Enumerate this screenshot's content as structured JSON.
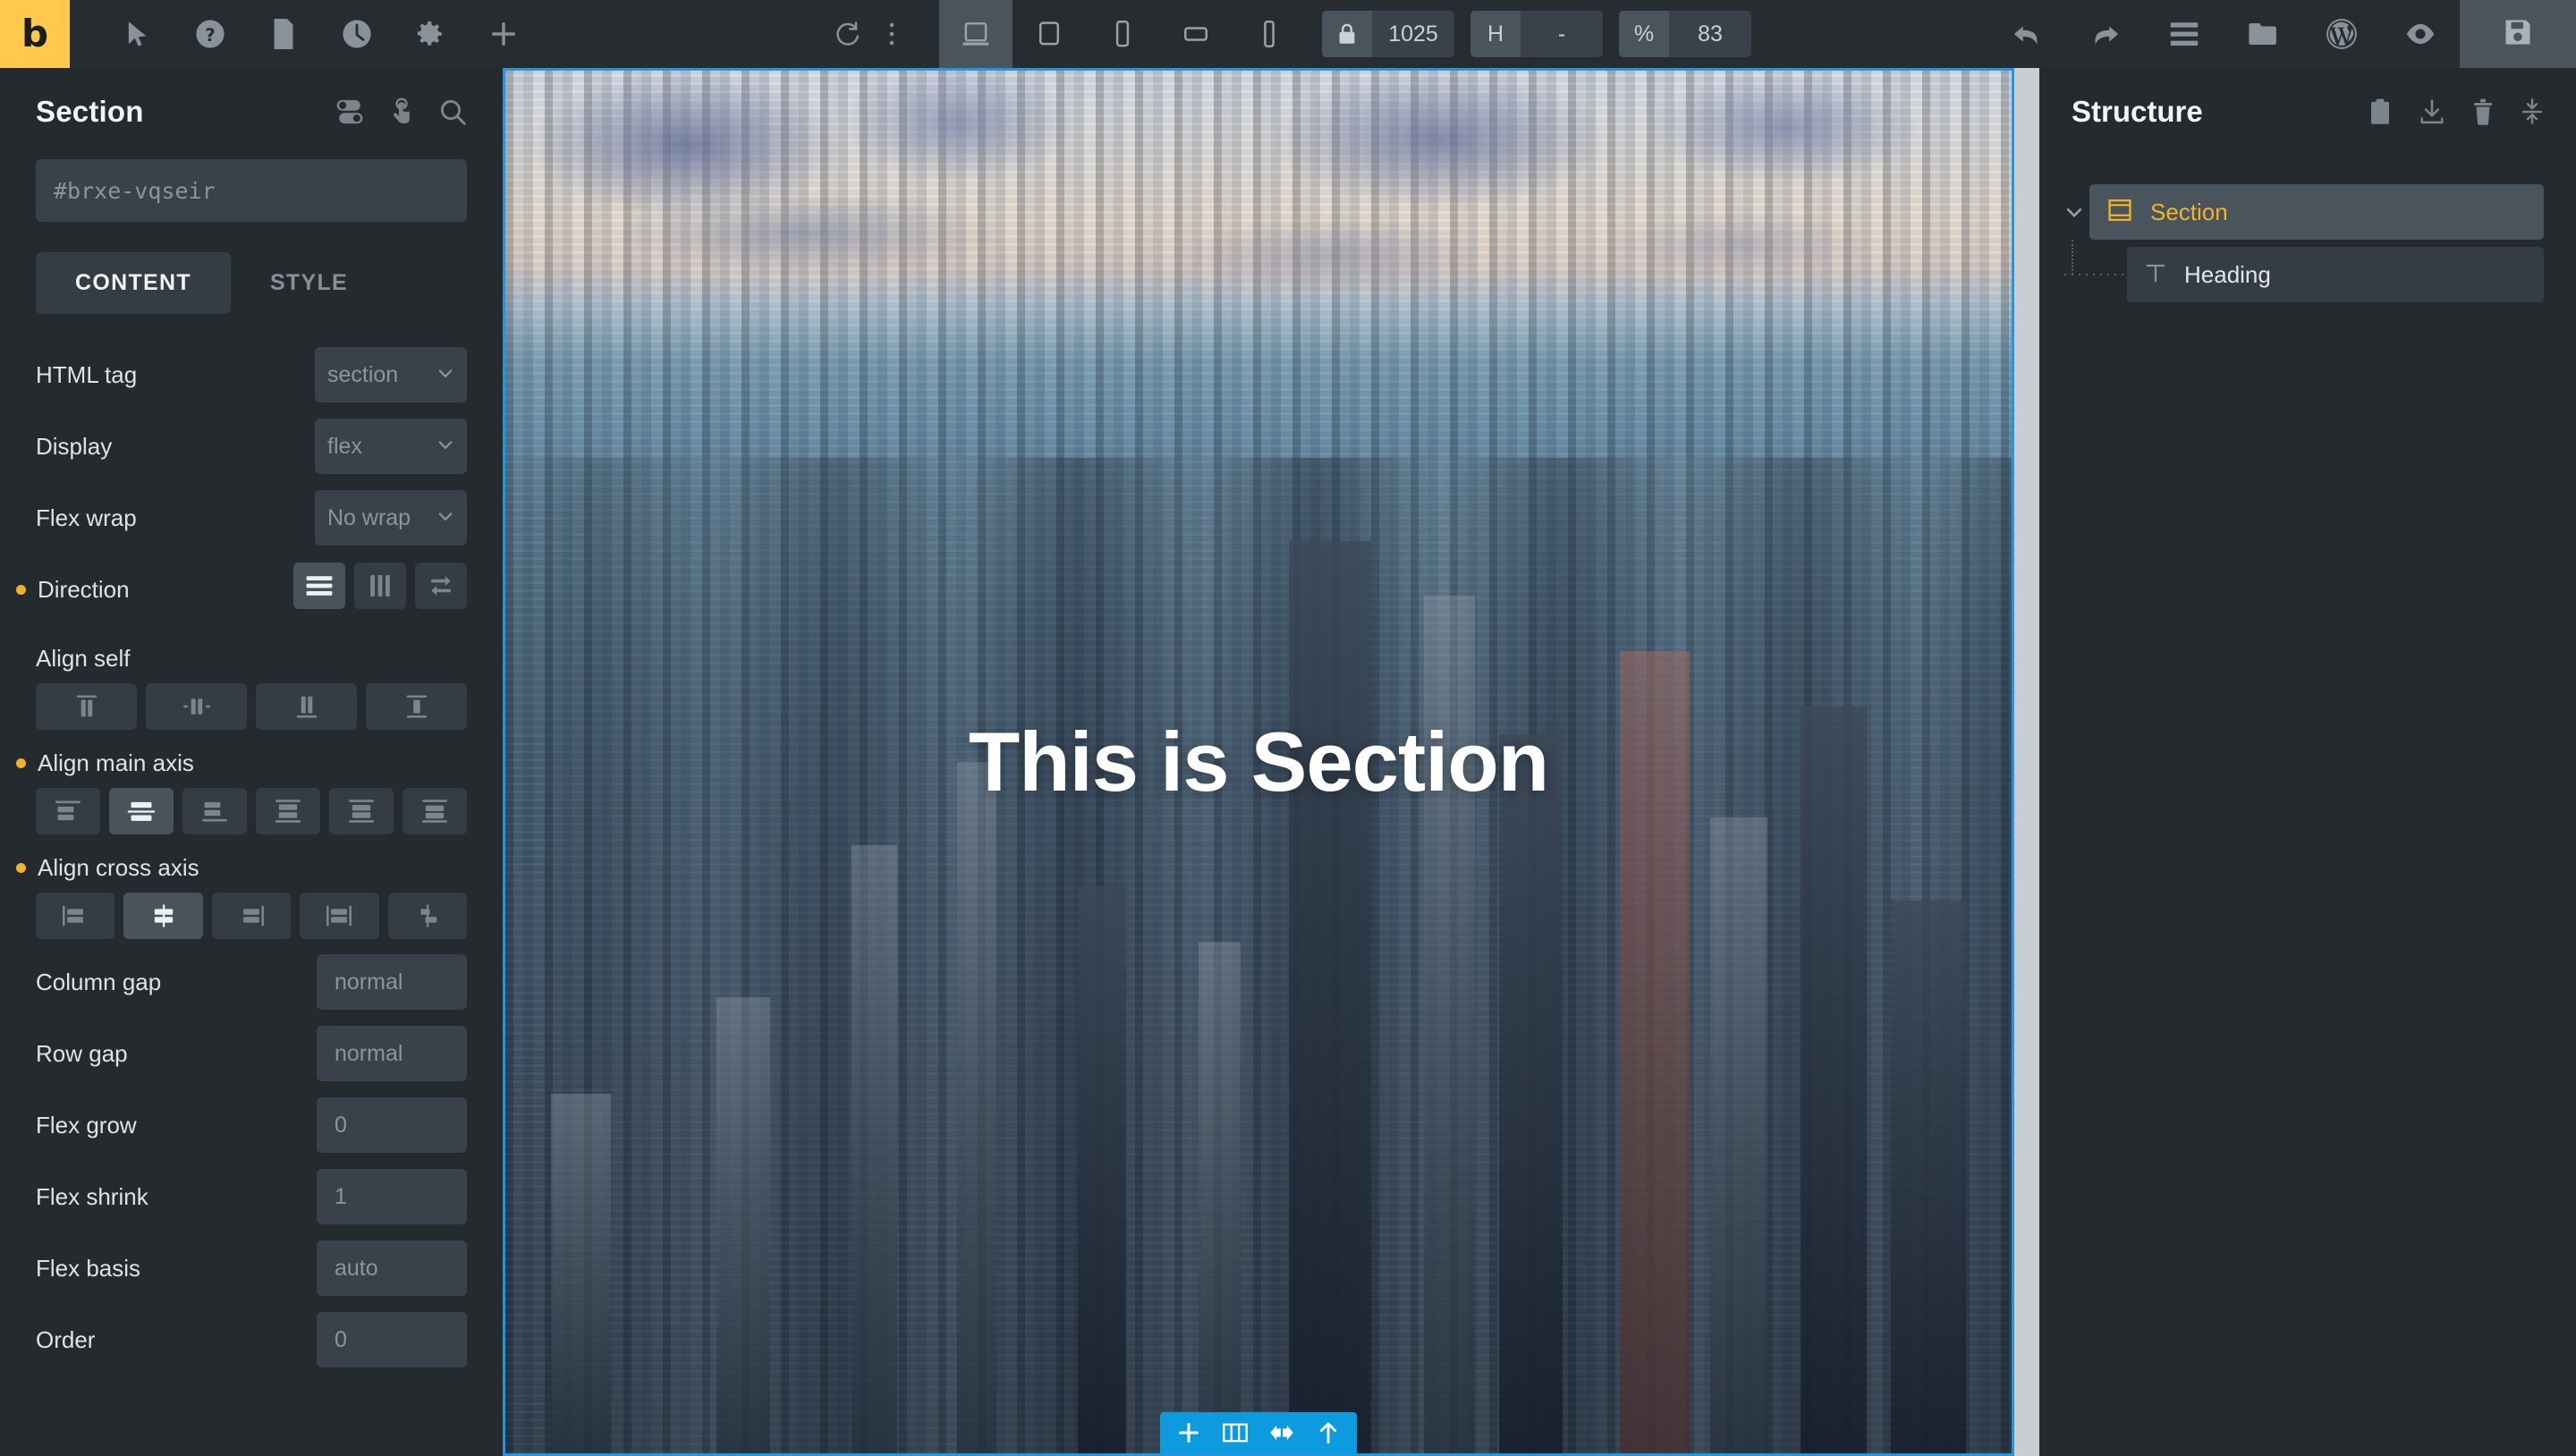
{
  "app": {
    "logo_letter": "b",
    "brand_color": "#ffc94d"
  },
  "toolbar": {
    "left_tools": [
      {
        "name": "cursor-icon",
        "label": "Select"
      },
      {
        "name": "help-icon",
        "label": "Help"
      },
      {
        "name": "page-icon",
        "label": "Page"
      },
      {
        "name": "history-icon",
        "label": "Revisions"
      },
      {
        "name": "gear-icon",
        "label": "Settings"
      },
      {
        "name": "plus-icon",
        "label": "Add element"
      }
    ],
    "center_tools": [
      {
        "name": "reload-icon",
        "label": "Reload"
      },
      {
        "name": "more-vertical-icon",
        "label": "More"
      }
    ],
    "devices": [
      {
        "name": "desktop-icon",
        "label": "Desktop",
        "active": true
      },
      {
        "name": "tablet-landscape-icon",
        "label": "Tablet landscape",
        "active": false
      },
      {
        "name": "tablet-portrait-icon",
        "label": "Tablet portrait",
        "active": false
      },
      {
        "name": "mobile-landscape-icon",
        "label": "Mobile landscape",
        "active": false
      },
      {
        "name": "mobile-portrait-icon",
        "label": "Mobile portrait",
        "active": false
      }
    ],
    "width_key": "lock-icon",
    "width_value": "1025",
    "height_key": "H",
    "height_value": "-",
    "zoom_key": "%",
    "zoom_value": "83",
    "right_tools": [
      {
        "name": "undo-icon",
        "label": "Undo"
      },
      {
        "name": "redo-icon",
        "label": "Redo"
      },
      {
        "name": "hamburger-icon",
        "label": "Structure panel"
      },
      {
        "name": "folder-icon",
        "label": "Templates"
      },
      {
        "name": "wordpress-icon",
        "label": "WordPress"
      },
      {
        "name": "eye-icon",
        "label": "Preview"
      }
    ],
    "save_label": "Save",
    "save_icon": "floppy-disk-icon"
  },
  "left_panel": {
    "title": "Section",
    "head_icons": [
      {
        "name": "toggle-sliders-icon",
        "label": "Settings"
      },
      {
        "name": "interactions-hand-icon",
        "label": "Interactions"
      },
      {
        "name": "search-icon",
        "label": "Search"
      }
    ],
    "id_value": "#brxe-vqseir",
    "tabs": [
      {
        "label": "CONTENT",
        "active": true
      },
      {
        "label": "STYLE",
        "active": false
      }
    ],
    "fields": {
      "html_tag": {
        "label": "HTML tag",
        "value": "section",
        "type": "select"
      },
      "display": {
        "label": "Display",
        "value": "flex",
        "type": "select"
      },
      "flex_wrap": {
        "label": "Flex wrap",
        "value": "No wrap",
        "type": "select"
      },
      "direction": {
        "label": "Direction",
        "modified": true,
        "options": [
          {
            "name": "direction-row-icon",
            "label": "Row",
            "active": true
          },
          {
            "name": "direction-column-icon",
            "label": "Column",
            "active": false
          },
          {
            "name": "direction-reverse-icon",
            "label": "Reverse",
            "active": false
          }
        ]
      },
      "align_self": {
        "label": "Align self",
        "modified": false,
        "options": [
          {
            "name": "align-self-start-icon",
            "label": "Start",
            "active": false
          },
          {
            "name": "align-self-center-icon",
            "label": "Center",
            "active": false
          },
          {
            "name": "align-self-end-icon",
            "label": "End",
            "active": false
          },
          {
            "name": "align-self-stretch-icon",
            "label": "Stretch",
            "active": false
          }
        ]
      },
      "align_main_axis": {
        "label": "Align main axis",
        "modified": true,
        "options": [
          {
            "name": "justify-flex-start-icon",
            "label": "Flex start",
            "active": false
          },
          {
            "name": "justify-center-icon",
            "label": "Center",
            "active": true
          },
          {
            "name": "justify-flex-end-icon",
            "label": "Flex end",
            "active": false
          },
          {
            "name": "justify-space-between-icon",
            "label": "Space between",
            "active": false
          },
          {
            "name": "justify-space-around-icon",
            "label": "Space around",
            "active": false
          },
          {
            "name": "justify-space-evenly-icon",
            "label": "Space evenly",
            "active": false
          }
        ]
      },
      "align_cross_axis": {
        "label": "Align cross axis",
        "modified": true,
        "options": [
          {
            "name": "align-flex-start-icon",
            "label": "Flex start",
            "active": false
          },
          {
            "name": "align-center-icon",
            "label": "Center",
            "active": true
          },
          {
            "name": "align-flex-end-icon",
            "label": "Flex end",
            "active": false
          },
          {
            "name": "align-stretch-icon",
            "label": "Stretch",
            "active": false
          },
          {
            "name": "align-baseline-icon",
            "label": "Baseline",
            "active": false
          }
        ]
      },
      "column_gap": {
        "label": "Column gap",
        "value": "normal",
        "type": "input"
      },
      "row_gap": {
        "label": "Row gap",
        "value": "normal",
        "type": "input"
      },
      "flex_grow": {
        "label": "Flex grow",
        "value": "0",
        "type": "input"
      },
      "flex_shrink": {
        "label": "Flex shrink",
        "value": "1",
        "type": "input"
      },
      "flex_basis": {
        "label": "Flex basis",
        "value": "auto",
        "type": "input"
      },
      "order": {
        "label": "Order",
        "value": "0",
        "type": "input"
      }
    }
  },
  "canvas": {
    "heading_text": "This is Section",
    "selection_color": "#2296e3",
    "element_toolbar": [
      {
        "name": "add-element-icon",
        "label": "Add"
      },
      {
        "name": "columns-icon",
        "label": "Columns"
      },
      {
        "name": "move-horizontal-icon",
        "label": "Move"
      },
      {
        "name": "move-up-icon",
        "label": "Move up"
      }
    ]
  },
  "right_panel": {
    "title": "Structure",
    "head_icons": [
      {
        "name": "clipboard-icon",
        "label": "Copy"
      },
      {
        "name": "download-icon",
        "label": "Import"
      },
      {
        "name": "trash-icon",
        "label": "Delete"
      },
      {
        "name": "collapse-icon",
        "label": "Collapse all"
      }
    ],
    "tree": [
      {
        "label": "Section",
        "icon": "section-icon",
        "selected": true,
        "expanded": true,
        "children": [
          {
            "label": "Heading",
            "icon": "text-t-icon",
            "selected": false
          }
        ]
      }
    ]
  }
}
